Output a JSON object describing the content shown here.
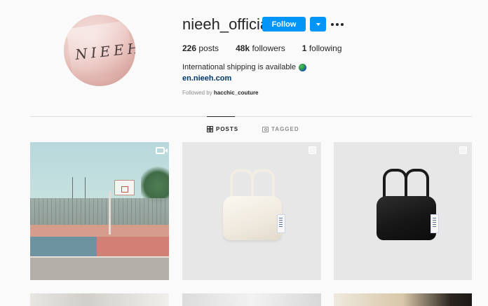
{
  "profile": {
    "username": "nieeh_official",
    "avatar_text": "NIEEH",
    "follow_label": "Follow",
    "stats": {
      "posts_count": "226",
      "posts_label": "posts",
      "followers_count": "48k",
      "followers_label": "followers",
      "following_count": "1",
      "following_label": "following"
    },
    "bio_line": "International shipping is available",
    "bio_icon": "globe-emoji-icon",
    "link": "en.nieeh.com",
    "followed_by_prefix": "Followed by",
    "followed_by_user": "hacchic_couture"
  },
  "tabs": [
    {
      "label": "POSTS",
      "icon": "grid-icon",
      "active": true
    },
    {
      "label": "TAGGED",
      "icon": "tag-icon",
      "active": false
    }
  ],
  "posts": [
    {
      "kind": "reel",
      "subject": "basketball court",
      "icon": "reel-icon"
    },
    {
      "kind": "carousel",
      "subject": "white handbag",
      "icon": "multiple-posts-icon"
    },
    {
      "kind": "carousel",
      "subject": "black handbag",
      "icon": "multiple-posts-icon"
    },
    {
      "kind": "photo"
    },
    {
      "kind": "photo"
    },
    {
      "kind": "photo"
    }
  ],
  "colors": {
    "accent": "#0095f6",
    "link": "#00376b",
    "muted": "#8e8e8e",
    "background": "#fafafa"
  }
}
